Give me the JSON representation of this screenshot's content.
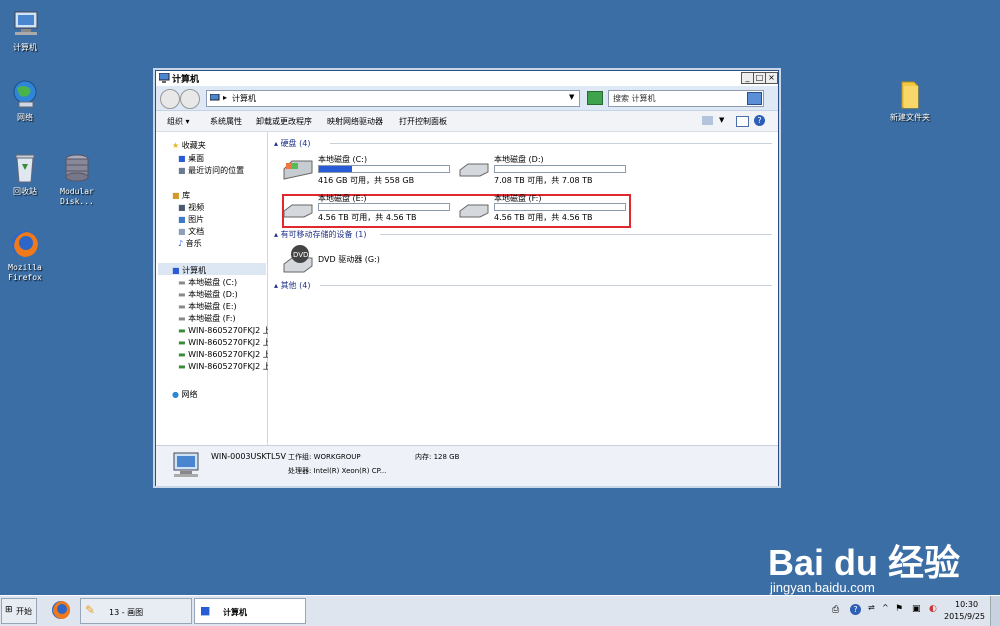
{
  "desktop": {
    "icons": [
      {
        "label": "计算机",
        "icon": "computer-icon"
      },
      {
        "label": "网络",
        "icon": "network-icon"
      },
      {
        "label": "回收站",
        "icon": "recycle-bin-icon"
      },
      {
        "label": "Modular Disk...",
        "icon": "disk-icon"
      },
      {
        "label": "Mozilla Firefox",
        "icon": "firefox-icon"
      },
      {
        "label": "新建文件夹",
        "icon": "folder-icon"
      }
    ]
  },
  "window": {
    "title": "计算机",
    "address": "计算机",
    "search_placeholder": "搜索 计算机",
    "toolbar": [
      "组织 ▾",
      "系统属性",
      "卸载或更改程序",
      "映射网络驱动器",
      "打开控制面板"
    ],
    "nav": {
      "favorites": "收藏夹",
      "fav_items": [
        "桌面",
        "最近访问的位置"
      ],
      "library": "库",
      "lib_items": [
        "视频",
        "图片",
        "文档",
        "音乐"
      ],
      "computer": "计算机",
      "comp_items": [
        "本地磁盘 (C:)",
        "本地磁盘 (D:)",
        "本地磁盘 (E:)",
        "本地磁盘 (F:)",
        "WIN-8605270FKJ2 上",
        "WIN-8605270FKJ2 上",
        "WIN-8605270FKJ2 上",
        "WIN-8605270FKJ2 上"
      ],
      "network": "网络"
    },
    "groups": {
      "hdd": "硬盘 (4)",
      "removable": "有可移动存储的设备 (1)",
      "other": "其他 (4)"
    },
    "drives": [
      {
        "name": "本地磁盘 (C:)",
        "info": "416 GB 可用，共 558 GB",
        "used_pct": 25
      },
      {
        "name": "本地磁盘 (D:)",
        "info": "7.08 TB 可用，共 7.08 TB",
        "used_pct": 0
      },
      {
        "name": "本地磁盘 (E:)",
        "info": "4.56 TB 可用，共 4.56 TB",
        "used_pct": 0
      },
      {
        "name": "本地磁盘 (F:)",
        "info": "4.56 TB 可用，共 4.56 TB",
        "used_pct": 0
      }
    ],
    "dvd": "DVD 驱动器 (G:)",
    "status": {
      "computer_name": "WIN-0003USKTL5V",
      "workgroup": "工作组: WORKGROUP",
      "memory": "内存: 128 GB",
      "processor": "处理器: Intel(R) Xeon(R) CP..."
    }
  },
  "taskbar": {
    "start": "开始",
    "tasks": [
      "13 - 画图",
      "计算机"
    ],
    "time": "10:30",
    "date": "2015/9/25"
  },
  "watermark": {
    "brand": "Bai du 经验",
    "url": "jingyan.baidu.com"
  }
}
